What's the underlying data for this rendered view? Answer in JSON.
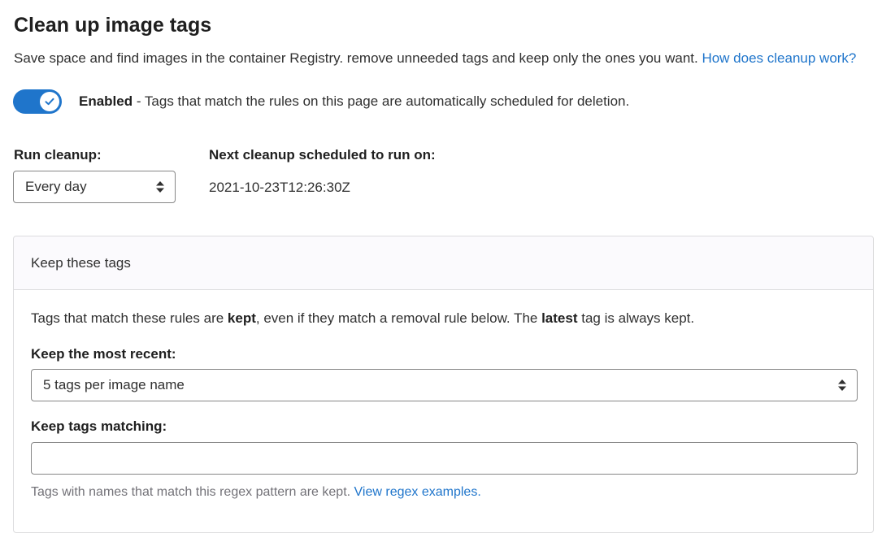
{
  "page": {
    "title": "Clean up image tags",
    "intro_text": "Save space and find images in the container Registry. remove unneeded tags and keep only the ones you want.",
    "intro_link": "How does cleanup work?"
  },
  "toggle": {
    "state": "on",
    "label_bold": "Enabled",
    "label_rest": " - Tags that match the rules on this page are automatically scheduled for deletion."
  },
  "run_cleanup": {
    "label": "Run cleanup:",
    "selected": "Every day"
  },
  "next_cleanup": {
    "label": "Next cleanup scheduled to run on:",
    "value": "2021-10-23T12:26:30Z"
  },
  "keep_card": {
    "header": "Keep these tags",
    "desc_part1": "Tags that match these rules are ",
    "desc_bold1": "kept",
    "desc_part2": ", even if they match a removal rule below. The ",
    "desc_bold2": "latest",
    "desc_part3": " tag is always kept.",
    "keep_recent_label": "Keep the most recent:",
    "keep_recent_selected": "5 tags per image name",
    "keep_matching_label": "Keep tags matching:",
    "keep_matching_value": "",
    "help_text": "Tags with names that match this regex pattern are kept.",
    "help_link": "View regex examples."
  },
  "colors": {
    "accent": "#1f75cb",
    "text": "#303030",
    "muted": "#737278"
  },
  "icons": {
    "toggle_check": "check-icon",
    "select_caret": "sort-caret-icon"
  }
}
